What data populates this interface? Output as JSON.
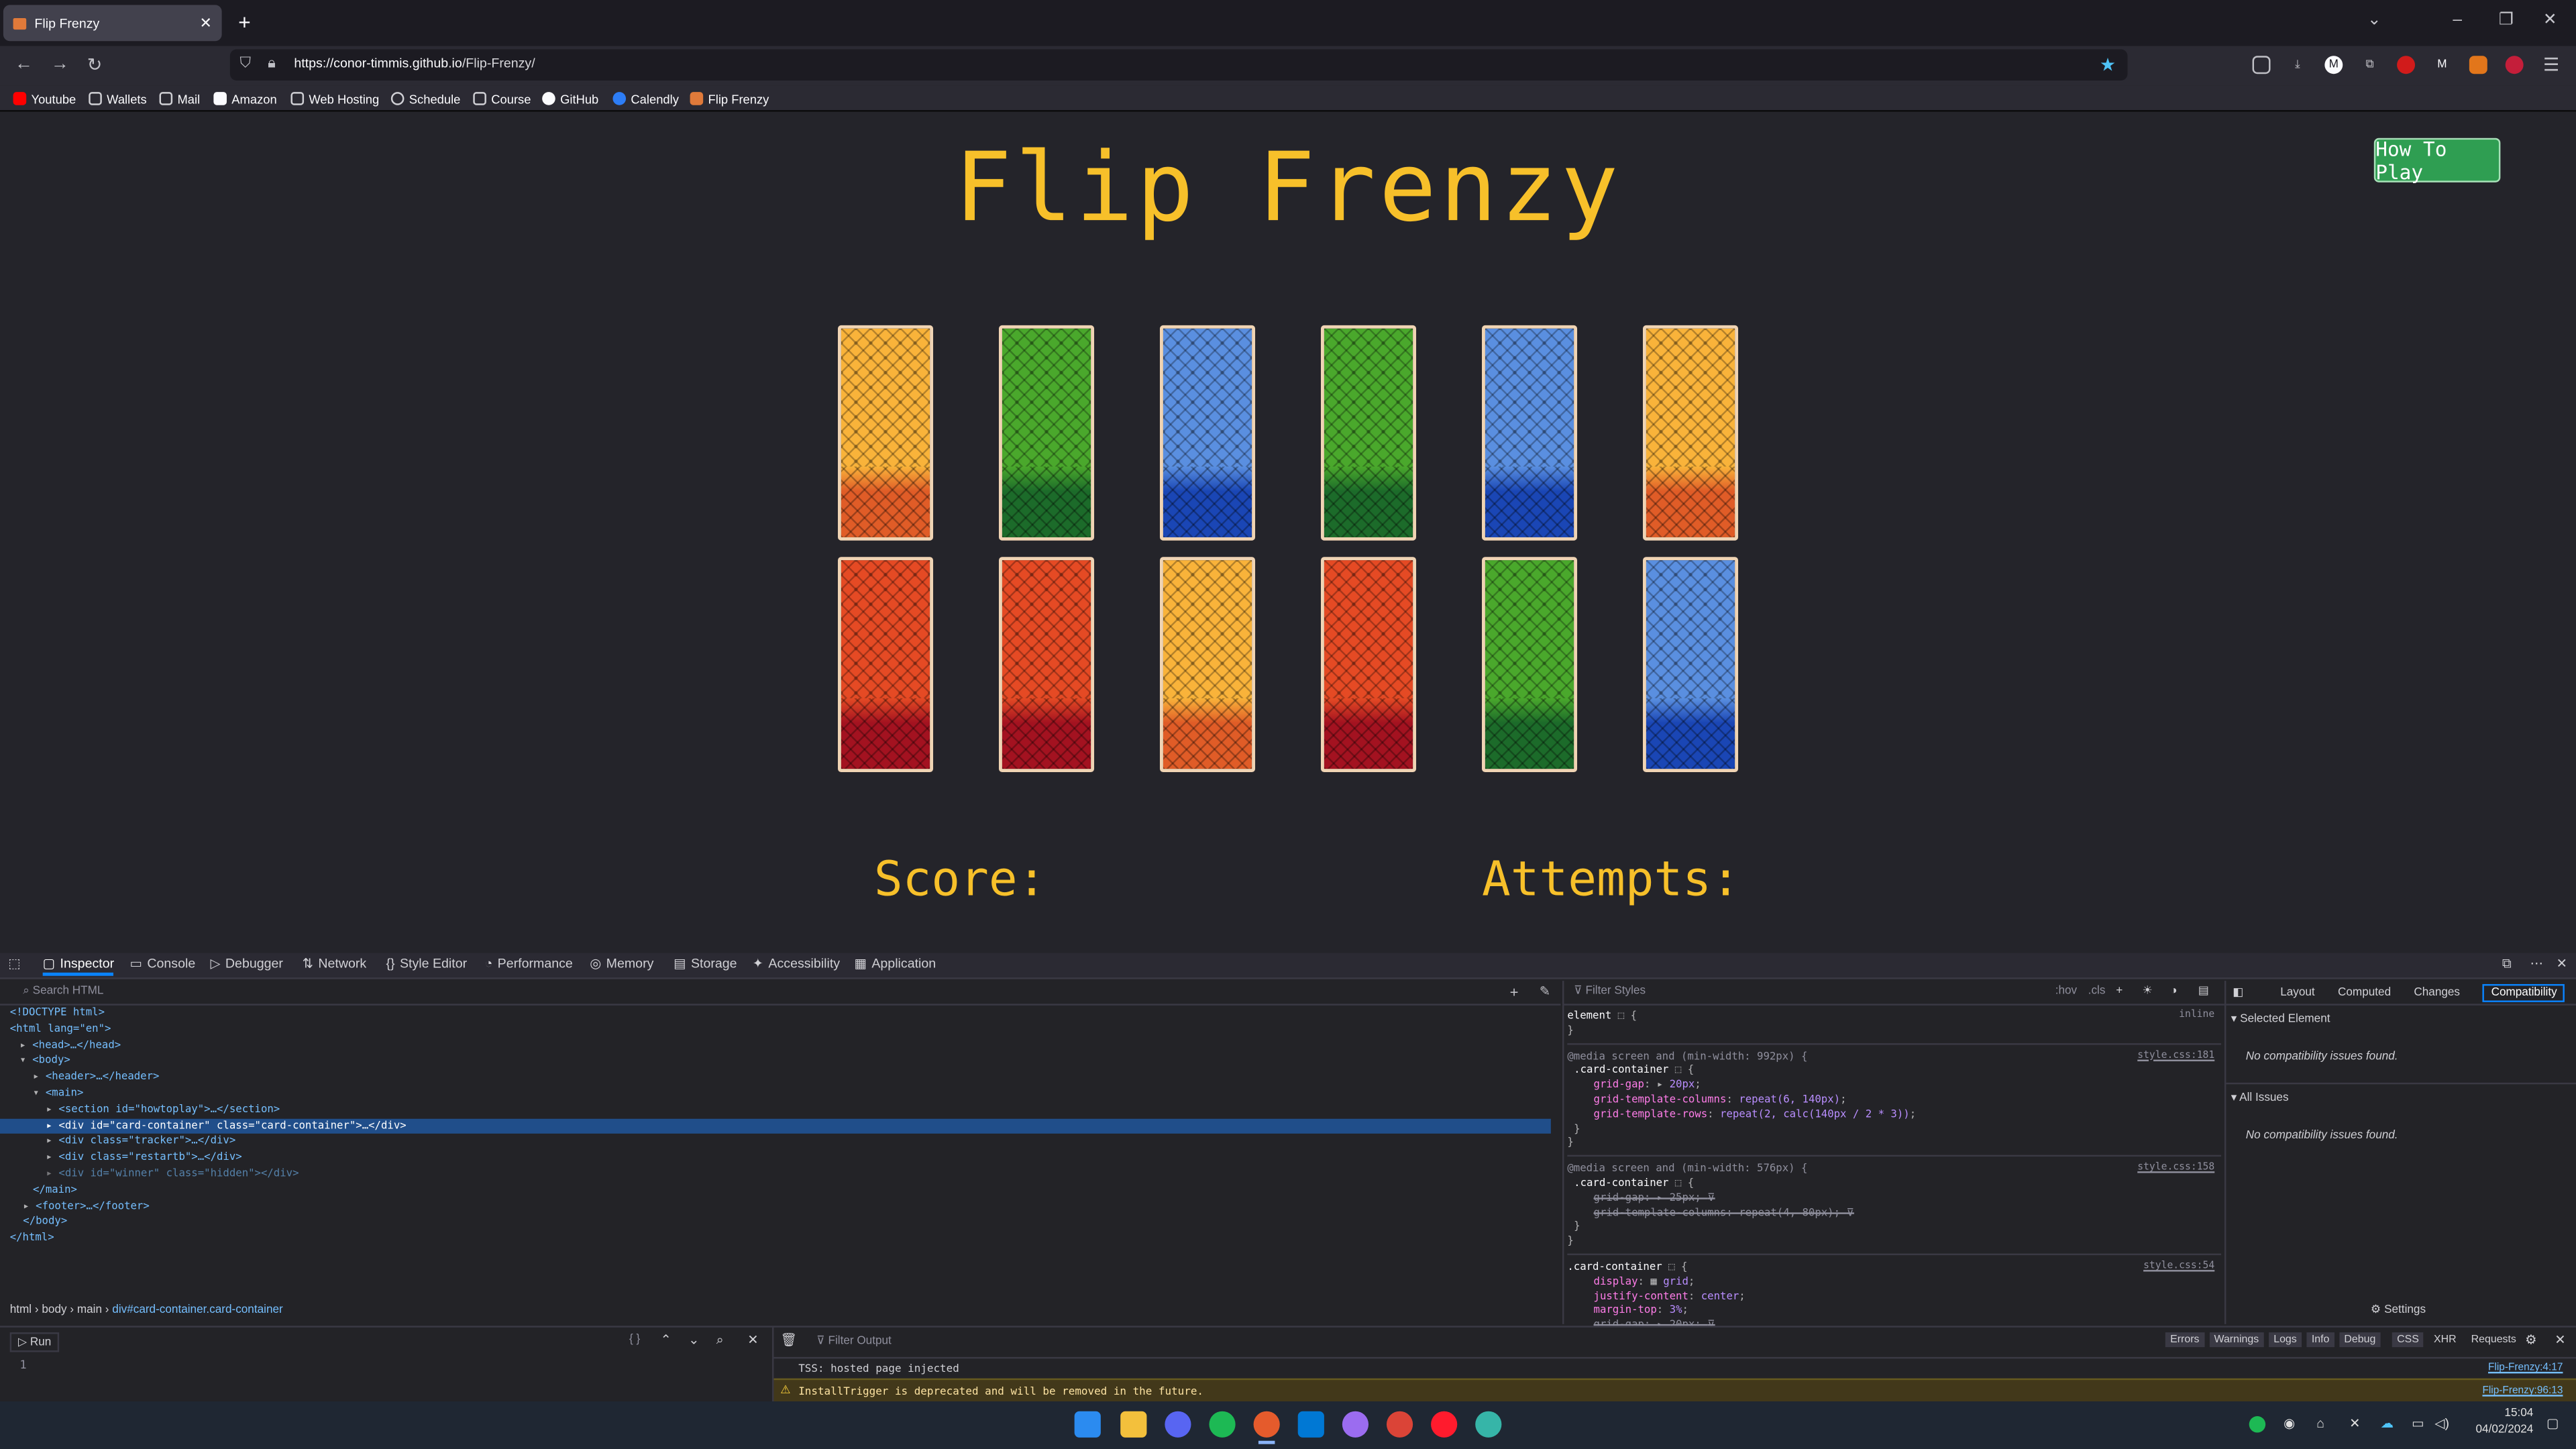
{
  "browser": {
    "tab_title": "Flip Frenzy",
    "tab_icon": "game-favicon",
    "url_host": "https://conor-timmis.github.io",
    "url_path": "/Flip-Frenzy/",
    "bookmarks": [
      "Youtube",
      "Wallets",
      "Mail",
      "Amazon",
      "Web Hosting",
      "Schedule",
      "Course",
      "GitHub",
      "Calendly",
      "Flip Frenzy"
    ]
  },
  "game": {
    "title": "Flip Frenzy",
    "how_to_play": "How To Play",
    "score_label": "Score:",
    "attempts_label": "Attempts:",
    "card_rows": [
      [
        "orange",
        "green",
        "blue",
        "green",
        "blue",
        "orange"
      ],
      [
        "red",
        "red",
        "orange",
        "red",
        "green",
        "blue"
      ]
    ],
    "card_colors": {
      "orange": [
        "#f9b33a",
        "#e05c27"
      ],
      "green": [
        "#4aa82c",
        "#1c6b2a"
      ],
      "blue": [
        "#5a8fe0",
        "#1a46b5"
      ],
      "red": [
        "#e54a24",
        "#a31220"
      ]
    }
  },
  "devtools": {
    "tabs": [
      "Inspector",
      "Console",
      "Debugger",
      "Network",
      "Style Editor",
      "Performance",
      "Memory",
      "Storage",
      "Accessibility",
      "Application"
    ],
    "search_placeholder": "Search HTML",
    "tree": [
      "<!DOCTYPE html>",
      "<html lang=\"en\">",
      "<head>…</head>",
      "<body>",
      "<header>…</header>",
      "<main>",
      "<section id=\"howtoplay\">…</section>",
      "<div id=\"card-container\" class=\"card-container\">…</div>",
      "<div class=\"tracker\">…</div>",
      "<div class=\"restartb\">…</div>",
      "<div id=\"winner\" class=\"hidden\"></div>",
      "</main>",
      "<footer>…</footer>",
      "</body>",
      "</html>"
    ],
    "breadcrumb": [
      "html",
      "body",
      "main",
      "div#card-container.card-container"
    ],
    "styles_filter": "Filter Styles",
    "styles_hov": ":hov",
    "styles_cls": ".cls",
    "element_rule": "element",
    "inline_label": "inline",
    "media1": "@media screen and (min-width: 992px) {",
    "media1_src": "style.css:181",
    "media2": "@media screen and (min-width: 576px) {",
    "media2_src": "style.css:158",
    "rule3_src": "style.css:54",
    "selector": ".card-container",
    "side_tabs": [
      "Layout",
      "Computed",
      "Changes",
      "Compatibility"
    ],
    "selected_element": "Selected Element",
    "all_issues": "All Issues",
    "no_issues": "No compatibility issues found.",
    "settings": "Settings",
    "console_run": "Run",
    "console_filter": "Filter Output",
    "console_levels": [
      "Errors",
      "Warnings",
      "Logs",
      "Info",
      "Debug",
      "CSS",
      "XHR",
      "Requests"
    ],
    "console_line1": "TSS: hosted page injected",
    "console_line1_src": "Flip-Frenzy:4:17",
    "console_line2": "InstallTrigger is deprecated and will be removed in the future.",
    "console_line2_src": "Flip-Frenzy:96:13",
    "console_line_no": "1"
  },
  "taskbar": {
    "time": "15:04",
    "date": "04/02/2024"
  }
}
